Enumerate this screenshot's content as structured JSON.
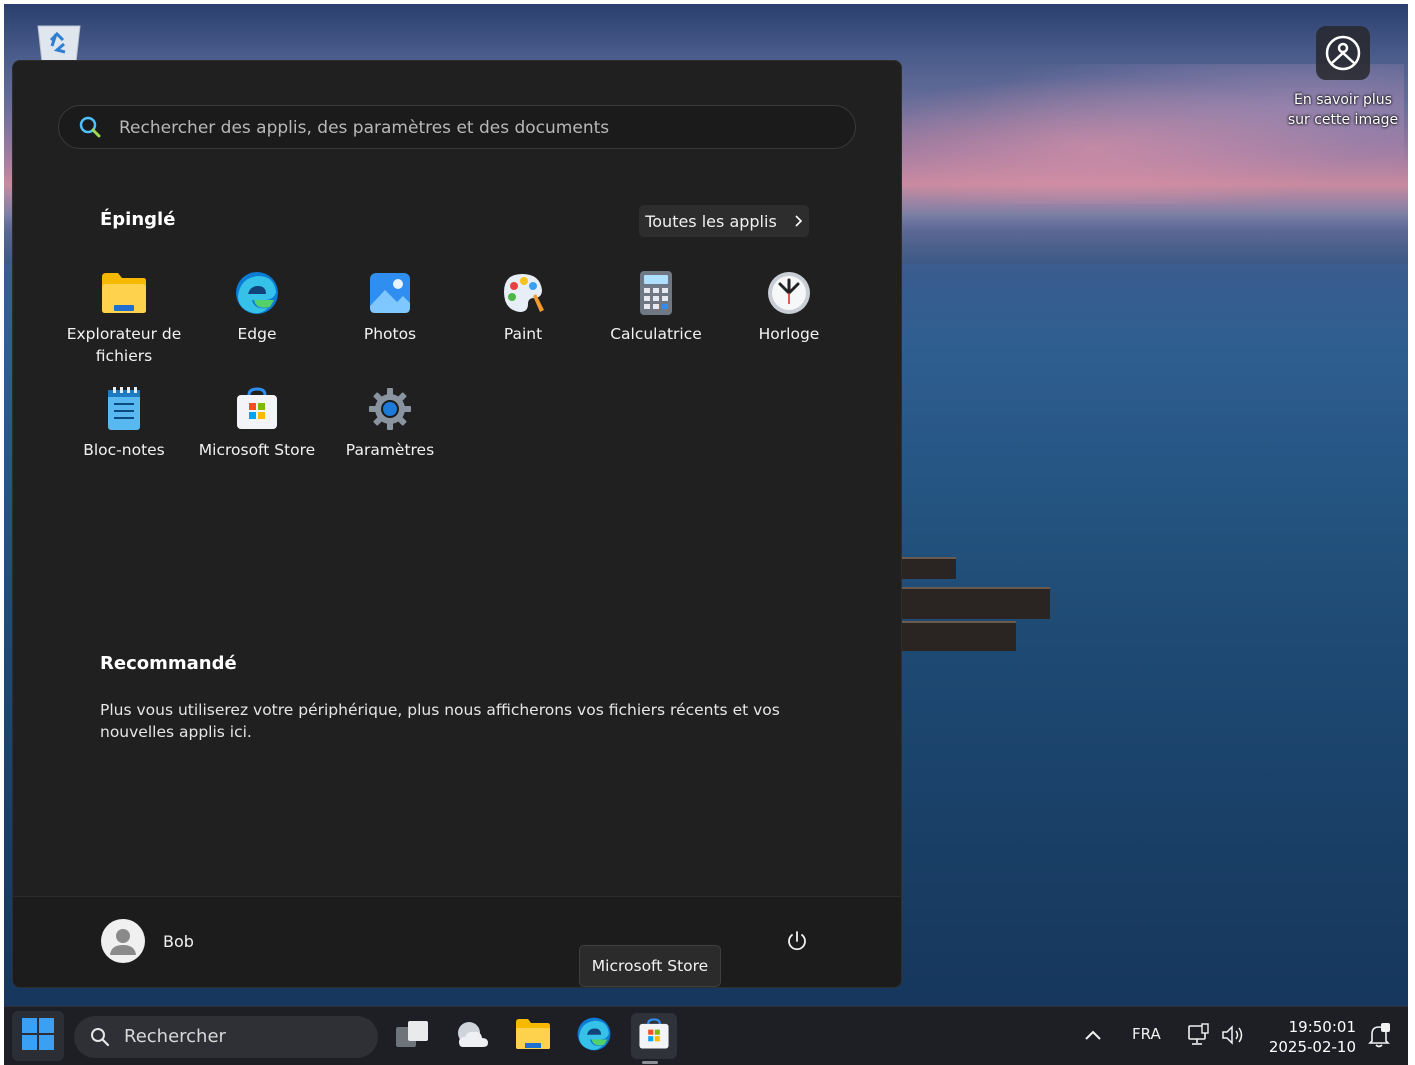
{
  "desktop": {
    "learn_more_text": "En savoir plus sur cette image"
  },
  "start_menu": {
    "search": {
      "placeholder": "Rechercher des applis, des paramètres et des documents",
      "value": ""
    },
    "pinned": {
      "title": "Épinglé",
      "all_apps_label": "Toutes les applis",
      "apps": [
        {
          "label": "Explorateur de fichiers",
          "icon": "file-explorer-icon"
        },
        {
          "label": "Edge",
          "icon": "edge-icon"
        },
        {
          "label": "Photos",
          "icon": "photos-icon"
        },
        {
          "label": "Paint",
          "icon": "paint-icon"
        },
        {
          "label": "Calculatrice",
          "icon": "calculator-icon"
        },
        {
          "label": "Horloge",
          "icon": "clock-icon"
        },
        {
          "label": "Bloc-notes",
          "icon": "notepad-icon"
        },
        {
          "label": "Microsoft Store",
          "icon": "store-icon"
        },
        {
          "label": "Paramètres",
          "icon": "settings-gear-icon"
        }
      ]
    },
    "recommended": {
      "title": "Recommandé",
      "text": "Plus vous utiliserez votre périphérique, plus nous afficherons vos fichiers récents et vos nouvelles applis ici."
    },
    "user": {
      "name": "Bob"
    }
  },
  "tooltip": {
    "text": "Microsoft Store"
  },
  "taskbar": {
    "search_label": "Rechercher",
    "apps": [
      "task-view-icon",
      "weather-icon",
      "file-explorer-icon",
      "edge-icon",
      "store-icon"
    ],
    "tray": {
      "language": "FRA",
      "time": "19:50:01",
      "date": "2025-02-10"
    }
  },
  "colors": {
    "menu_bg": "#202020",
    "taskbar_bg": "#1d1f24",
    "accent": "#0078d4"
  }
}
